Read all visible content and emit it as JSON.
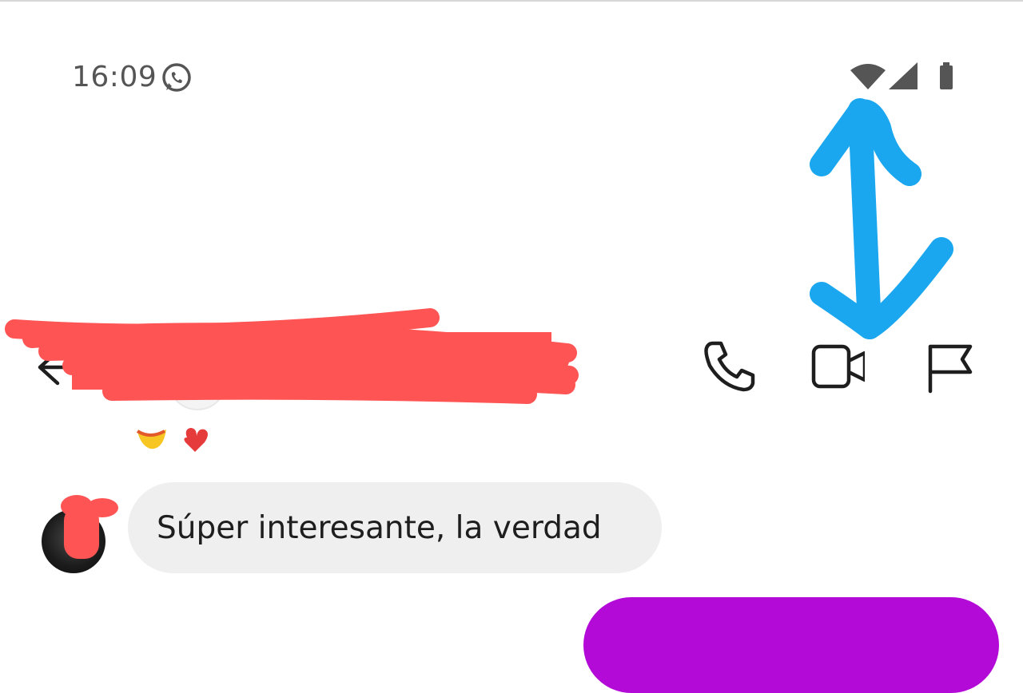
{
  "status_bar": {
    "time": "16:09",
    "notification_icon": "whatsapp-icon",
    "icons": [
      "wifi-icon",
      "signal-icon",
      "battery-icon"
    ]
  },
  "header": {
    "back_icon": "back-arrow-icon",
    "actions": [
      "phone-icon",
      "video-camera-icon",
      "flag-icon"
    ]
  },
  "messages": [
    {
      "direction": "received",
      "text": "Súper interesante, la verdad"
    }
  ],
  "colors": {
    "received_bubble": "#efefef",
    "sent_bubble": "#b30ad8",
    "annotation_arrow": "#1aa7ef",
    "redaction": "#ff5454"
  }
}
